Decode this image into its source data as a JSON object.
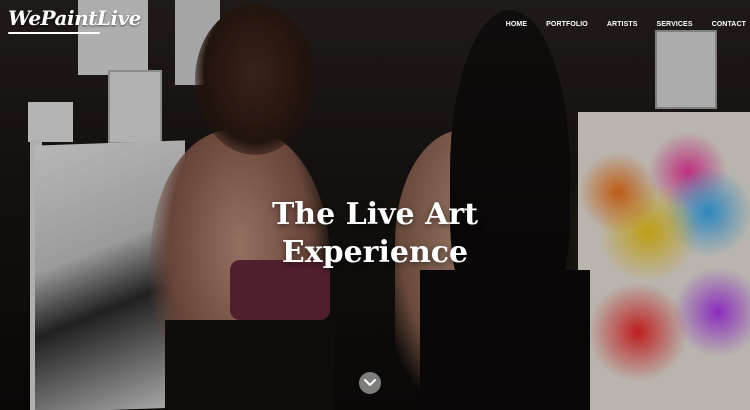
{
  "brand": {
    "logo_text": "WePaintLive"
  },
  "nav": {
    "items": [
      {
        "label": "HOME"
      },
      {
        "label": "PORTFOLIO"
      },
      {
        "label": "ARTISTS"
      },
      {
        "label": "SERVICES"
      },
      {
        "label": "CONTACT"
      }
    ]
  },
  "hero": {
    "title_line1": "The Live Art",
    "title_line2": "Experience",
    "scroll_icon": "chevron-down-icon"
  }
}
